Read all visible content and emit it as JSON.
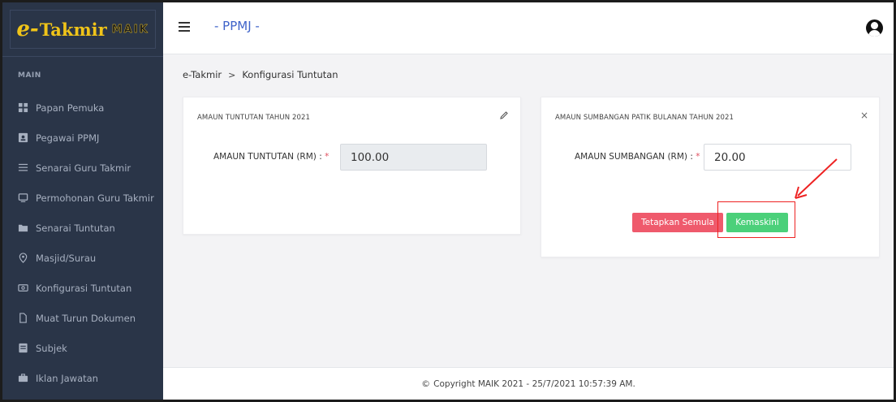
{
  "sidebar": {
    "logo": {
      "prefix": "e-",
      "name": "Takmir",
      "suffix": "MAIK"
    },
    "section": "MAIN",
    "items": [
      {
        "label": "Papan Pemuka",
        "icon": "dashboard-icon"
      },
      {
        "label": "Pegawai PPMJ",
        "icon": "id-card-icon"
      },
      {
        "label": "Senarai Guru Takmir",
        "icon": "list-icon"
      },
      {
        "label": "Permohonan Guru Takmir",
        "icon": "monitor-icon"
      },
      {
        "label": "Senarai Tuntutan",
        "icon": "folder-icon"
      },
      {
        "label": "Masjid/Surau",
        "icon": "map-pin-icon"
      },
      {
        "label": "Konfigurasi Tuntutan",
        "icon": "money-icon"
      },
      {
        "label": "Muat Turun Dokumen",
        "icon": "document-icon"
      },
      {
        "label": "Subjek",
        "icon": "book-icon"
      },
      {
        "label": "Iklan Jawatan",
        "icon": "briefcase-icon"
      }
    ]
  },
  "topbar": {
    "title": "- PPMJ -"
  },
  "breadcrumb": {
    "home": "e-Takmir",
    "separator": ">",
    "current": "Konfigurasi Tuntutan"
  },
  "card_claim": {
    "title": "AMAUN TUNTUTAN TAHUN 2021",
    "label": "AMAUN TUNTUTAN (RM) :",
    "required_mark": "*",
    "value": "100.00"
  },
  "card_contribution": {
    "title": "AMAUN SUMBANGAN PATIK BULANAN TAHUN 2021",
    "label": "AMAUN SUMBANGAN (RM) :",
    "required_mark": "*",
    "value": "20.00",
    "close": "×",
    "reset_label": "Tetapkan Semula",
    "update_label": "Kemaskini"
  },
  "footer": {
    "text": "Copyright MAIK 2021 - 25/7/2021 10:57:39 AM."
  },
  "colors": {
    "sidebar_bg": "#2a3548",
    "accent_blue": "#3f63c9",
    "reset_red": "#ef5a6c",
    "update_green": "#4bd07a",
    "logo_yellow": "#f0c419"
  }
}
